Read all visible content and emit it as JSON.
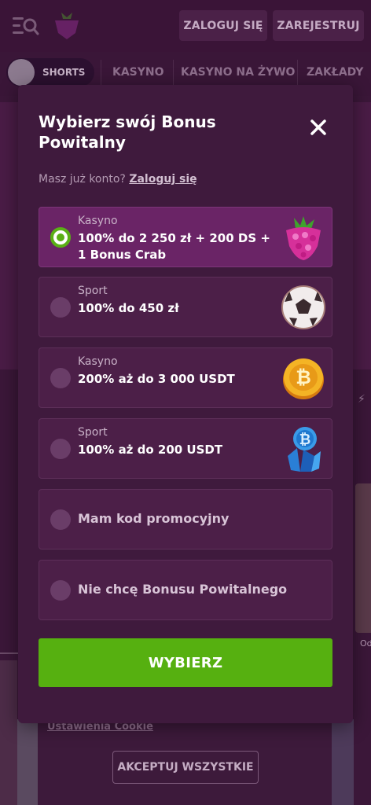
{
  "header": {
    "login_label": "ZALOGUJ SIĘ",
    "register_label": "ZAREJESTRUJ"
  },
  "nav": {
    "shorts_label": "SHORTS",
    "items": [
      "KASYNO",
      "KASYNO NA ŻYWO",
      "ZAKŁADY"
    ]
  },
  "background": {
    "right_text": "Od",
    "cookie_settings_label": "Ustawienia Cookie",
    "cookie_accept_label": "AKCEPTUJ WSZYSTKIE"
  },
  "modal": {
    "title": "Wybierz swój Bonus Powitalny",
    "subtitle_text": "Masz już konto?",
    "subtitle_link": "Zaloguj się",
    "options": [
      {
        "category": "Kasyno",
        "text": "100% do 2 250 zł + 200 DS + 1 Bonus Crab",
        "selected": true,
        "icon": "raspberry-icon"
      },
      {
        "category": "Sport",
        "text": "100% do 450 zł",
        "selected": false,
        "icon": "soccer-ball-icon"
      },
      {
        "category": "Kasyno",
        "text": "200% aż do 3 000 USDT",
        "selected": false,
        "icon": "bitcoin-coin-icon"
      },
      {
        "category": "Sport",
        "text": "100% aż do 200 USDT",
        "selected": false,
        "icon": "bitcoin-crystal-icon"
      },
      {
        "text": "Mam kod promocyjny",
        "selected": false
      },
      {
        "text": "Nie chcę Bonusu Powitalnego",
        "selected": false
      }
    ],
    "cta_label": "WYBIERZ"
  },
  "colors": {
    "accent_green": "#56b010",
    "modal_bg": "#3f1a3d",
    "option_bg": "#4c1f48",
    "option_selected_bg": "#6a2466"
  }
}
